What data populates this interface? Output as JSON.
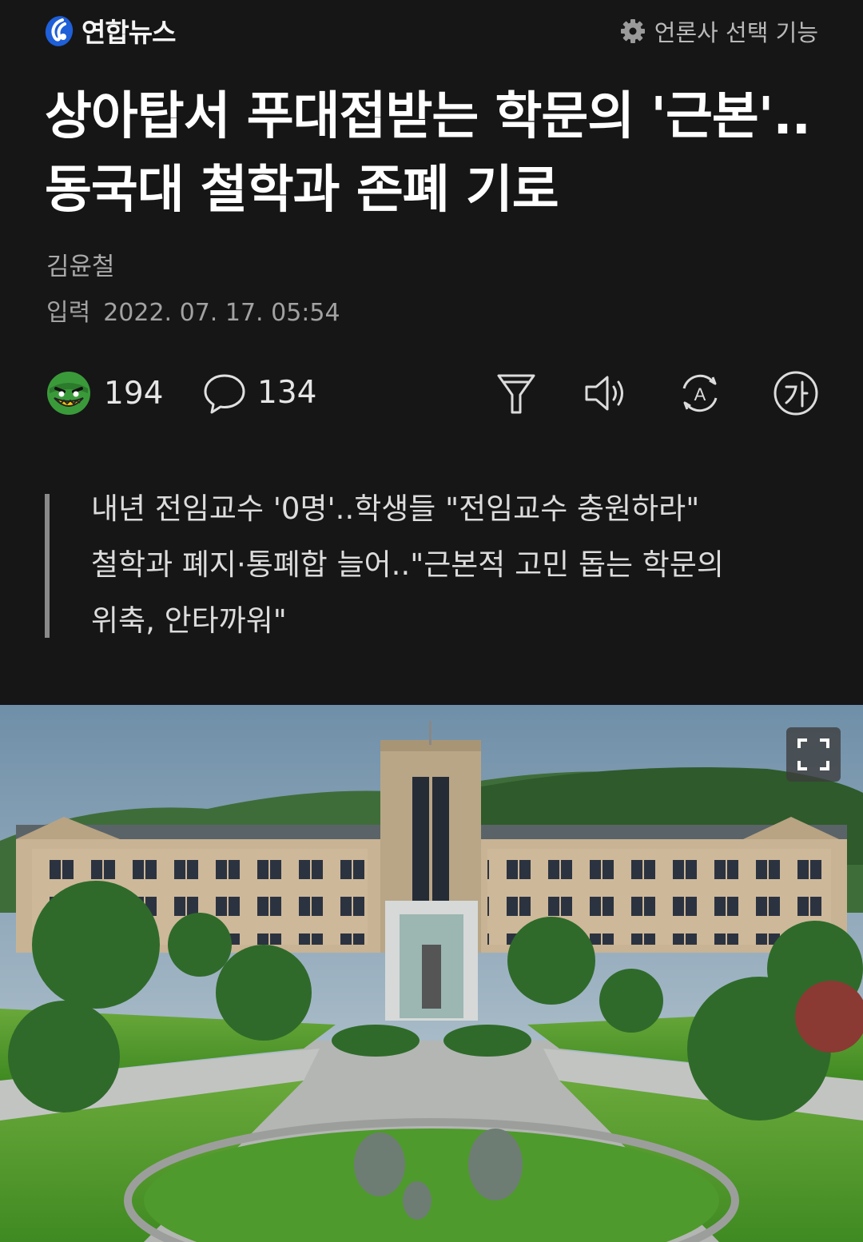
{
  "header": {
    "logo_text": "연합뉴스",
    "publisher_select": "언론사 선택 기능",
    "icons": {
      "publisher": "gear-icon"
    }
  },
  "article": {
    "headline_line1": "상아탑서 푸대접받는 학문의 '근본'..",
    "headline_line2": "동국대 철학과 존폐 기로",
    "author": "김윤철",
    "date_label": "입력",
    "date_value": "2022. 07. 17. 05:54"
  },
  "actions": {
    "reaction_count": "194",
    "comment_count": "134",
    "icons": [
      "emoji-reaction-icon",
      "comment-icon",
      "filter-icon",
      "speaker-icon",
      "translate-icon",
      "font-size-icon"
    ]
  },
  "summary": {
    "line1": "내년 전임교수 '0명'..학생들 \"전임교수 충원하라\"",
    "line2": "철학과 폐지·통폐합 늘어..\"근본적 고민 돕는 학문의",
    "line3": "위축, 안타까워\""
  },
  "photo": {
    "description_icon": "expand-icon"
  },
  "colors": {
    "background": "#161616",
    "text": "#ffffff",
    "muted": "#a9a9a9",
    "quote_bar": "#8a8a8a",
    "logo_blue": "#1f5fd8"
  }
}
